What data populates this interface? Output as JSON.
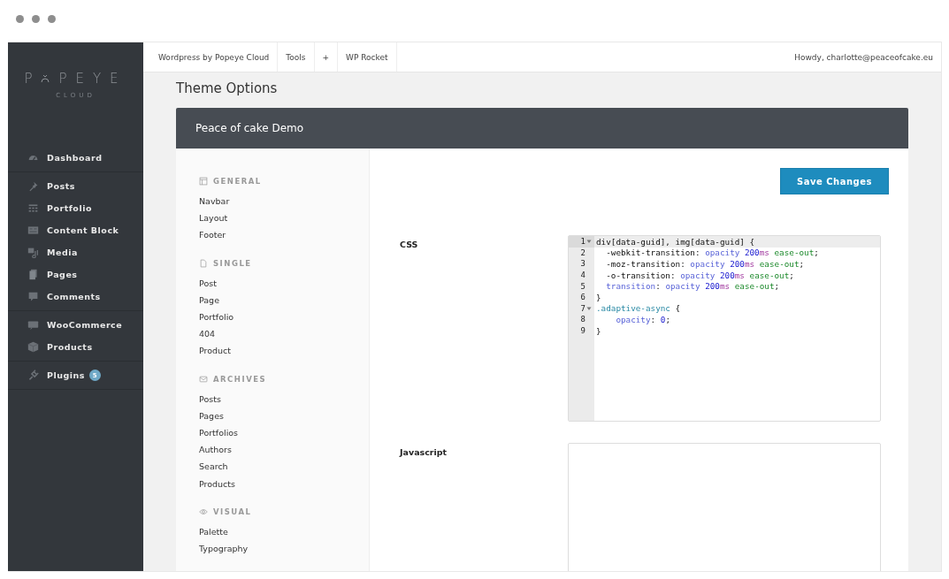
{
  "logo": {
    "start": "P",
    "end": "PEYE",
    "sub": "CLOUD"
  },
  "sidebar": {
    "groups": [
      [
        {
          "label": "Dashboard"
        }
      ],
      [
        {
          "label": "Posts"
        },
        {
          "label": "Portfolio"
        },
        {
          "label": "Content Block"
        },
        {
          "label": "Media"
        },
        {
          "label": "Pages"
        },
        {
          "label": "Comments"
        }
      ],
      [
        {
          "label": "WooCommerce"
        },
        {
          "label": "Products"
        }
      ],
      [
        {
          "label": "Plugins",
          "badge": "5"
        }
      ]
    ]
  },
  "topbar": {
    "items": [
      "Wordpress by Popeye Cloud",
      "Tools",
      "+",
      "WP Rocket"
    ],
    "user": "Howdy, charlotte@peaceofcake.eu"
  },
  "page_title": "Theme Options",
  "panel": {
    "title": "Peace of cake Demo",
    "nav": [
      {
        "heading": "GENERAL",
        "items": [
          "Navbar",
          "Layout",
          "Footer"
        ]
      },
      {
        "heading": "SINGLE",
        "items": [
          "Post",
          "Page",
          "Portfolio",
          "404",
          "Product"
        ]
      },
      {
        "heading": "ARCHIVES",
        "items": [
          "Posts",
          "Pages",
          "Portfolios",
          "Authors",
          "Search",
          "Products"
        ]
      },
      {
        "heading": "VISUAL",
        "items": [
          "Palette",
          "Typography"
        ]
      }
    ],
    "save_button": "Save Changes",
    "fields": [
      {
        "label": "CSS",
        "lines": [
          {
            "number": "1",
            "fold": true,
            "active": true,
            "tokens": [
              {
                "kind": "plain",
                "text": "div[data-guid], img[data-guid] {"
              }
            ]
          },
          {
            "number": "2",
            "fold": false,
            "active": false,
            "tokens": [
              {
                "kind": "plain",
                "text": "  -webkit-transition: "
              },
              {
                "kind": "value",
                "text": "opacity "
              },
              {
                "kind": "number",
                "text": "200"
              },
              {
                "kind": "unit",
                "text": "ms"
              },
              {
                "kind": "keyword",
                "text": " ease-out"
              },
              {
                "kind": "plain",
                "text": ";"
              }
            ]
          },
          {
            "number": "3",
            "fold": false,
            "active": false,
            "tokens": [
              {
                "kind": "plain",
                "text": "  -moz-transition: "
              },
              {
                "kind": "value",
                "text": "opacity "
              },
              {
                "kind": "number",
                "text": "200"
              },
              {
                "kind": "unit",
                "text": "ms"
              },
              {
                "kind": "keyword",
                "text": " ease-out"
              },
              {
                "kind": "plain",
                "text": ";"
              }
            ]
          },
          {
            "number": "4",
            "fold": false,
            "active": false,
            "tokens": [
              {
                "kind": "plain",
                "text": "  -o-transition: "
              },
              {
                "kind": "value",
                "text": "opacity "
              },
              {
                "kind": "number",
                "text": "200"
              },
              {
                "kind": "unit",
                "text": "ms"
              },
              {
                "kind": "keyword",
                "text": " ease-out"
              },
              {
                "kind": "plain",
                "text": ";"
              }
            ]
          },
          {
            "number": "5",
            "fold": false,
            "active": false,
            "tokens": [
              {
                "kind": "value",
                "text": "  transition"
              },
              {
                "kind": "plain",
                "text": ": "
              },
              {
                "kind": "value",
                "text": "opacity "
              },
              {
                "kind": "number",
                "text": "200"
              },
              {
                "kind": "unit",
                "text": "ms"
              },
              {
                "kind": "keyword",
                "text": " ease-out"
              },
              {
                "kind": "plain",
                "text": ";"
              }
            ]
          },
          {
            "number": "6",
            "fold": false,
            "active": false,
            "tokens": [
              {
                "kind": "plain",
                "text": "}"
              }
            ]
          },
          {
            "number": "7",
            "fold": true,
            "active": false,
            "tokens": [
              {
                "kind": "class",
                "text": ".adaptive-async"
              },
              {
                "kind": "plain",
                "text": " {"
              }
            ]
          },
          {
            "number": "8",
            "fold": false,
            "active": false,
            "tokens": [
              {
                "kind": "value",
                "text": "    opacity"
              },
              {
                "kind": "plain",
                "text": ": "
              },
              {
                "kind": "number",
                "text": "0"
              },
              {
                "kind": "plain",
                "text": ";"
              }
            ]
          },
          {
            "number": "9",
            "fold": false,
            "active": false,
            "tokens": [
              {
                "kind": "plain",
                "text": "}"
              }
            ]
          }
        ]
      },
      {
        "label": "Javascript"
      }
    ]
  }
}
